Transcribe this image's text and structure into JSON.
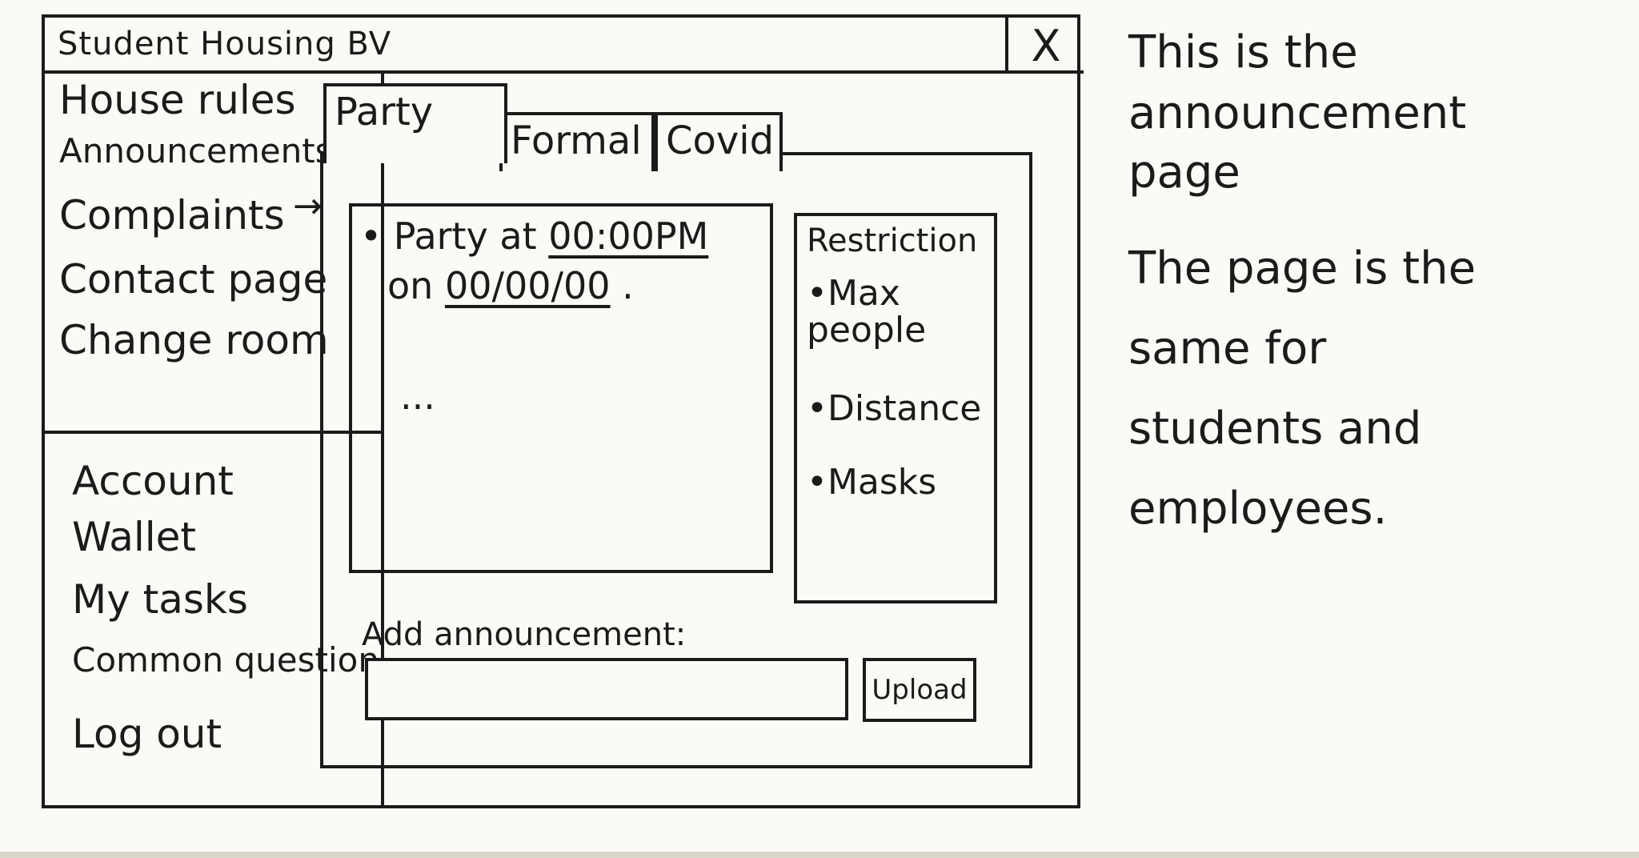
{
  "window": {
    "title": "Student Housing BV",
    "close_label": "X"
  },
  "sidebar": {
    "items": [
      {
        "label": "House rules"
      },
      {
        "label": "Announcements"
      },
      {
        "label": "Complaints"
      },
      {
        "label": "Contact page"
      },
      {
        "label": "Change room"
      }
    ],
    "arrow": "→",
    "account_items": [
      {
        "label": "Account"
      },
      {
        "label": "Wallet"
      },
      {
        "label": "My tasks"
      },
      {
        "label": "Common question"
      },
      {
        "label": "Log out"
      }
    ]
  },
  "tabs": [
    {
      "label": "Party",
      "active": true
    },
    {
      "label": "Formal",
      "active": false
    },
    {
      "label": "Covid",
      "active": false
    }
  ],
  "announcement": {
    "bullet": "•",
    "line1_prefix": "Party at",
    "time": "00:00PM",
    "line2_prefix": "on",
    "date": "00/00/00",
    "line2_suffix": ".",
    "ellipsis": "..."
  },
  "restrictions": {
    "title": "Restriction",
    "items": [
      "•Max people",
      "•Distance",
      "•Masks"
    ]
  },
  "add": {
    "label": "Add announcement:",
    "input_value": "",
    "upload_label": "Upload"
  },
  "notes": {
    "lines": [
      "This is the",
      "announcement",
      "page",
      "The page is the",
      "same for",
      "students and",
      "employees."
    ]
  }
}
